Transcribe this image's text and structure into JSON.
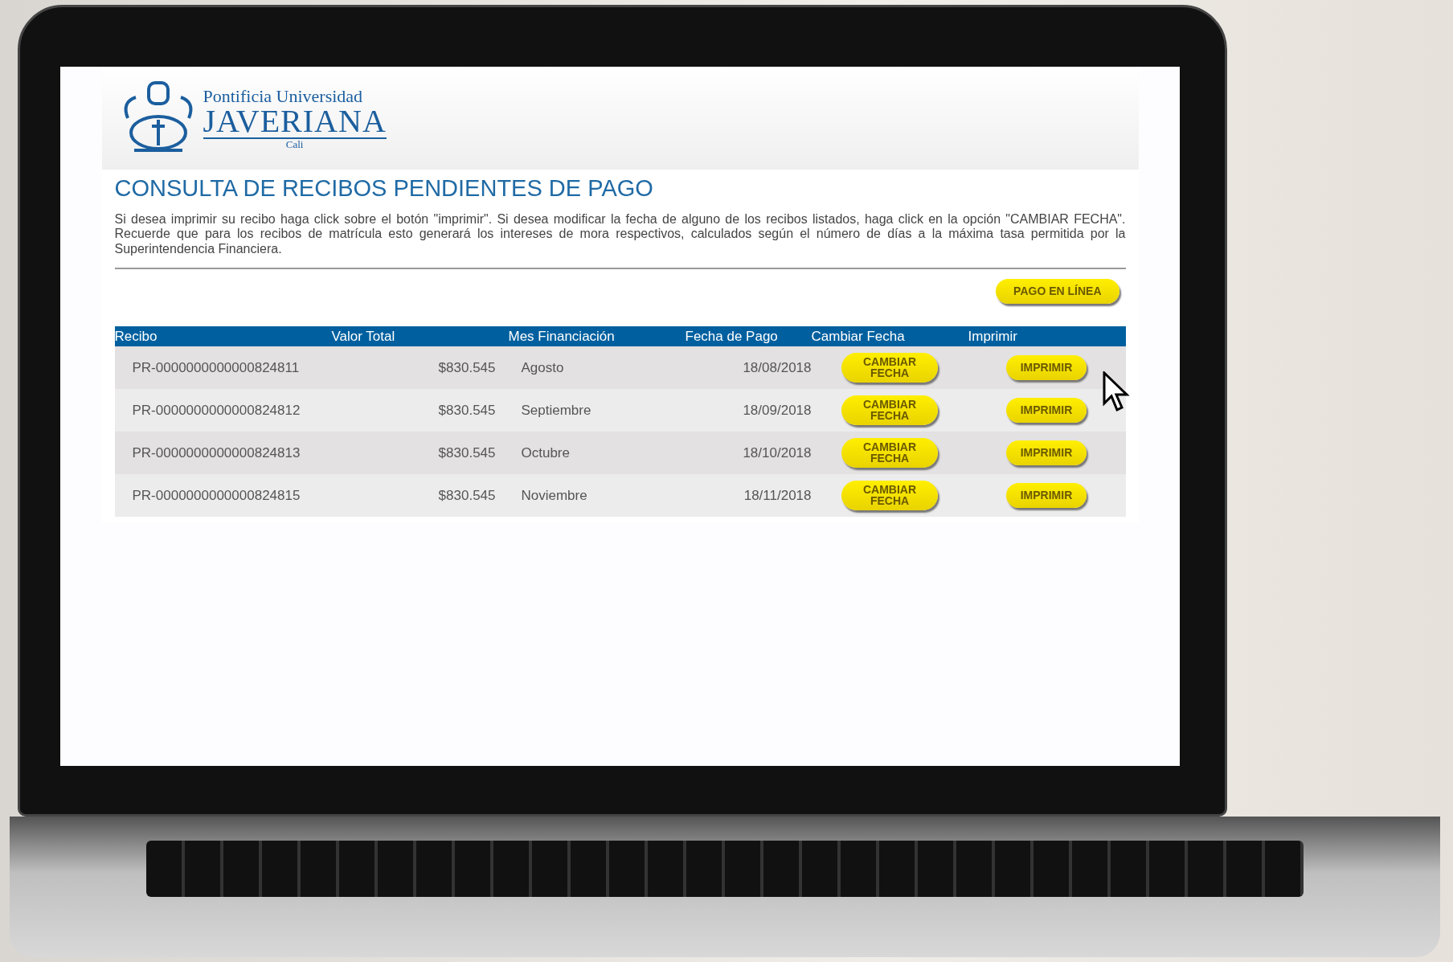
{
  "logo": {
    "line_1": "Pontificia Universidad",
    "line_2": "JAVERIANA",
    "line_3": "Cali"
  },
  "title": "CONSULTA DE RECIBOS PENDIENTES DE PAGO",
  "intro": "Si desea imprimir su recibo haga click sobre el botón \"imprimir\". Si desea modificar la fecha de alguno de los recibos listados, haga click en la opción \"CAMBIAR FECHA\". Recuerde que para los recibos de matrícula esto generará los intereses de mora respectivos, calculados según el número de días a la máxima tasa permitida por la Superintendencia Financiera.",
  "online_payment_button": "PAGO EN LÍNEA",
  "table": {
    "columns": [
      "Recibo",
      "Valor Total",
      "Mes Financiación",
      "Fecha de Pago",
      "Cambiar Fecha",
      "Imprimir"
    ],
    "rows": [
      {
        "recibo": "PR-0000000000000824811",
        "valor": "$830.545",
        "mes": "Agosto",
        "fecha": "18/08/2018",
        "change_button": "CAMBIAR FECHA",
        "print_button": "IMPRIMIR"
      },
      {
        "recibo": "PR-0000000000000824812",
        "valor": "$830.545",
        "mes": "Septiembre",
        "fecha": "18/09/2018",
        "change_button": "CAMBIAR FECHA",
        "print_button": "IMPRIMIR"
      },
      {
        "recibo": "PR-0000000000000824813",
        "valor": "$830.545",
        "mes": "Octubre",
        "fecha": "18/10/2018",
        "change_button": "CAMBIAR FECHA",
        "print_button": "IMPRIMIR"
      },
      {
        "recibo": "PR-0000000000000824815",
        "valor": "$830.545",
        "mes": "Noviembre",
        "fecha": "18/11/2018",
        "change_button": "CAMBIAR FECHA",
        "print_button": "IMPRIMIR"
      }
    ]
  }
}
